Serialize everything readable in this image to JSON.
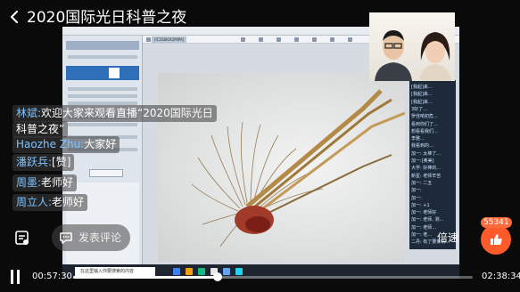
{
  "header": {
    "title": "2020国际光日科普之夜"
  },
  "screen_share": {
    "camera_tab": "[IC2S6KIX2MIPA]",
    "taskbar_search": "在这里输入你要搜索的内容"
  },
  "comments": [
    {
      "name": "林斌:",
      "text": "欢迎大家来观看直播“2020国际光日"
    },
    {
      "name": "",
      "text": "科普之夜”"
    },
    {
      "name": "Haozhe Zhu:",
      "text": "大家好"
    },
    {
      "name": "潘跃兵:",
      "text": "[赞]"
    },
    {
      "name": "周墨:",
      "text": "老师好"
    },
    {
      "name": "周立人:",
      "text": "老师好"
    }
  ],
  "chat_panel": {
    "lines": [
      "[我起]来...",
      "[我起]来...",
      "[我起]来...",
      "3好了...",
      "罗佳响初危...",
      "看到你们了...",
      "想看看我们...",
      "李雅...",
      "我看到的...",
      "加一: 太棒了...",
      "加一:[奥美]",
      "大学: 好棒的...",
      "新星: 老师辛苦",
      "加一: 二五",
      "加一:",
      "加一:",
      "加一: +1",
      "加一: 老师好",
      "加一: 老师, 测...",
      "加一: 老师...",
      "加一: 老...",
      "二丹: 有了要象情..."
    ]
  },
  "controls": {
    "comment_placeholder": "发表评论",
    "speed_label": "倍速",
    "like_count": "55341",
    "time_current": "00:57:30",
    "time_total": "02:38:34",
    "progress": 0.3626,
    "accent_color": "#ff5a2a"
  },
  "icons": {
    "back": "chevron-left-icon",
    "doc": "document-icon",
    "comment": "comment-icon",
    "like": "thumbs-up-icon",
    "pause": "pause-icon"
  }
}
